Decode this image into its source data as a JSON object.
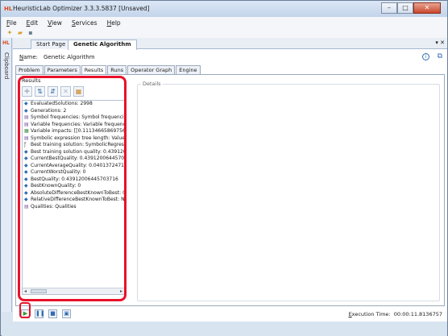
{
  "window": {
    "title": "HeuristicLab Optimizer 3.3.3.5837 [Unsaved]",
    "app_icon": "heuristiclab-icon",
    "controls": {
      "minimize": "–",
      "maximize": "□",
      "close": "✕"
    }
  },
  "menu": {
    "items": [
      {
        "underlined": "F",
        "rest": "ile"
      },
      {
        "underlined": "E",
        "rest": "dit"
      },
      {
        "underlined": "V",
        "rest": "iew"
      },
      {
        "underlined": "S",
        "rest": "ervices"
      },
      {
        "underlined": "H",
        "rest": "elp"
      }
    ]
  },
  "sidebar": {
    "label": "Clipboard",
    "logo": "HL"
  },
  "document_tabs": {
    "items": [
      "Start Page",
      "Genetic Algorithm"
    ],
    "active_index": 1,
    "overflow": "▾ ✕"
  },
  "name": {
    "label_underlined": "N",
    "label_rest": "ame:",
    "value": "Genetic Algorithm"
  },
  "sub_tabs": {
    "items": [
      "Problem",
      "Parameters",
      "Results",
      "Runs",
      "Operator Graph",
      "Engine"
    ],
    "active_index": 2
  },
  "results": {
    "title": "Results",
    "items": [
      {
        "icon": "value-icon",
        "text": "EvaluatedSolutions: 2998"
      },
      {
        "icon": "value-icon",
        "text": "Generations: 2"
      },
      {
        "icon": "table-icon",
        "text": "Symbol frequencies: Symbol frequencies"
      },
      {
        "icon": "table-icon",
        "text": "Variable frequencies: Variable frequencies"
      },
      {
        "icon": "matrix-icon",
        "text": "Variable impacts: [[0.111346658697566][0.11("
      },
      {
        "icon": "table-icon",
        "text": "Symbolic expression tree length: Values"
      },
      {
        "icon": "model-icon",
        "text": "Best training solution: SymbolicRegressionSolu"
      },
      {
        "icon": "value-icon",
        "text": "Best training solution quality: 0.439120064457"
      },
      {
        "icon": "value-icon",
        "text": "CurrentBestQuality: 0.43912006445703716"
      },
      {
        "icon": "value-icon",
        "text": "CurrentAverageQuality: 0.0401372471497722"
      },
      {
        "icon": "value-icon",
        "text": "CurrentWorstQuality: 0"
      },
      {
        "icon": "value-icon",
        "text": "BestQuality: 0.43912006445703716"
      },
      {
        "icon": "value-icon",
        "text": "BestKnownQuality: 0"
      },
      {
        "icon": "value-icon",
        "text": "AbsoluteDifferenceBestKnownToBest: 0.4391"
      },
      {
        "icon": "value-icon",
        "text": "RelativeDifferenceBestKnownToBest: NaN"
      },
      {
        "icon": "table-icon",
        "text": "Qualities: Qualities"
      }
    ]
  },
  "details": {
    "label": "Details"
  },
  "execution": {
    "label_underlined": "E",
    "label_rest": "xecution Time:",
    "value": "00:00:11.8136757"
  },
  "colors": {
    "highlight": "#e8122a",
    "accent": "#2f6cb3",
    "play": "#2e9a2e"
  }
}
